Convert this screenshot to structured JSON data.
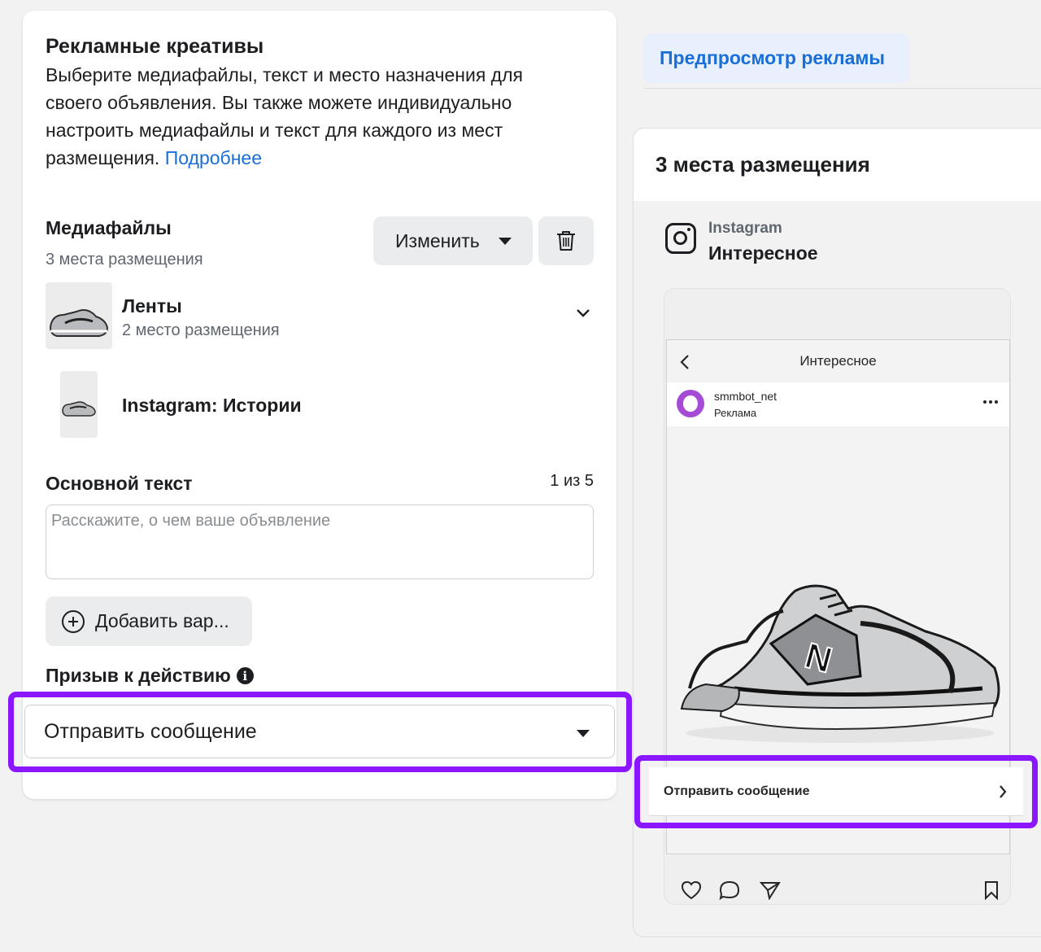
{
  "creatives": {
    "title": "Рекламные креативы",
    "description": "Выберите медиафайлы, текст и место назначения для своего объявления. Вы также можете индивидуально настроить медиафайлы и текст для каждого из мест размещения.",
    "learn_more": "Подробнее"
  },
  "media": {
    "title": "Медиафайлы",
    "subtitle": "3 места размещения",
    "change_label": "Изменить",
    "items": [
      {
        "title": "Ленты",
        "subtitle": "2 место размещения"
      },
      {
        "title": "Instagram: Истории",
        "subtitle": ""
      }
    ]
  },
  "primary_text": {
    "title": "Основной текст",
    "counter": "1 из 5",
    "placeholder": "Расскажите, о чем ваше объявление",
    "add_variant_label": "Добавить вар..."
  },
  "cta": {
    "title": "Призыв к действию",
    "selected": "Отправить сообщение"
  },
  "preview": {
    "tab_label": "Предпросмотр рекламы",
    "placements_header": "3 места размещения",
    "platform": "Instagram",
    "placement": "Интересное",
    "screen_title": "Интересное",
    "account_name": "smmbot_net",
    "sponsored": "Реклама",
    "cta_label": "Отправить сообщение"
  },
  "colors": {
    "highlight": "#8a17ff",
    "link": "#1a6ed8",
    "avatar": "#a64bd6"
  }
}
